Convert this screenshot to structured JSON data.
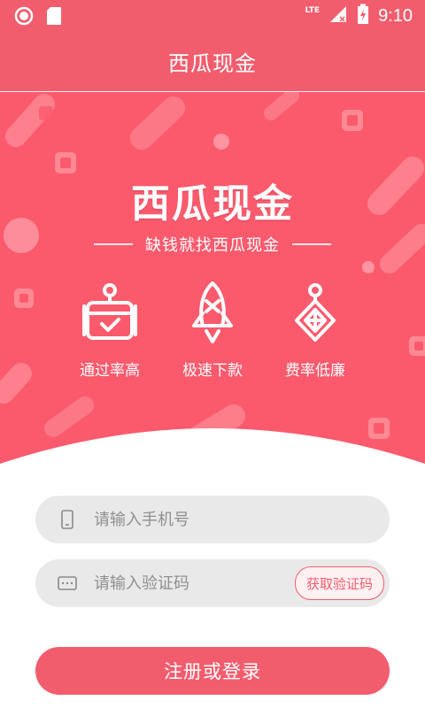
{
  "status_bar": {
    "time": "9:10",
    "network": "LTE",
    "icons": [
      "circle-notification-icon",
      "sd-card-icon",
      "signal-icon",
      "battery-charging-icon"
    ]
  },
  "app_bar": {
    "title": "西瓜现金"
  },
  "banner": {
    "title": "西瓜现金",
    "subtitle": "缺钱就找西瓜现金",
    "features": [
      {
        "icon": "calendar-check-icon",
        "label": "通过率高"
      },
      {
        "icon": "rocket-icon",
        "label": "极速下款"
      },
      {
        "icon": "price-tag-icon",
        "label": "费率低廉"
      }
    ]
  },
  "form": {
    "phone": {
      "placeholder": "请输入手机号",
      "value": "",
      "icon": "phone-icon"
    },
    "code": {
      "placeholder": "请输入验证码",
      "value": "",
      "icon": "keyboard-icon",
      "button_label": "获取验证码"
    },
    "submit_label": "注册或登录"
  },
  "colors": {
    "primary": "#f25d6e",
    "banner": "#fb5a6d",
    "input_bg": "#e9e9e9",
    "placeholder": "#8f8f8f"
  }
}
